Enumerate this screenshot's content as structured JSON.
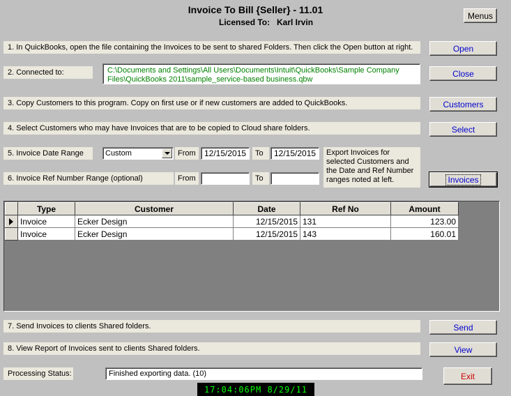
{
  "header": {
    "title": "Invoice To Bill {Seller} - 11.01",
    "licensed_label": "Licensed To:",
    "licensed_name": "Karl Irvin"
  },
  "buttons": {
    "menus": "Menus",
    "open": "Open",
    "close": "Close",
    "customers": "Customers",
    "select": "Select",
    "invoices": "Invoices",
    "send": "Send",
    "view": "View",
    "exit": "Exit"
  },
  "steps": {
    "step1": "1. In QuickBooks, open the  file containing the Invoices to be sent to shared Folders. Then click the Open button at right.",
    "step2": "2. Connected to:",
    "connected_path": "C:\\Documents and Settings\\All Users\\Documents\\Intuit\\QuickBooks\\Sample Company Files\\QuickBooks 2011\\sample_service-based business.qbw",
    "step3": "3. Copy Customers to this program. Copy on first use or if new customers are added to QuickBooks.",
    "step4": "4. Select Customers who may have Invoices that are to be copied to Cloud share folders.",
    "step5": "5. Invoice Date Range",
    "step6": "6. Invoice Ref Number Range (optional)",
    "step7": "7. Send Invoices to clients Shared folders.",
    "step8": "8. View Report of Invoices sent to clients Shared folders."
  },
  "date_range": {
    "preset": "Custom",
    "from_label": "From",
    "from_value": "12/15/2015",
    "to_label": "To",
    "to_value": "12/15/2015"
  },
  "ref_range": {
    "from_label": "From",
    "from_value": "",
    "to_label": "To",
    "to_value": ""
  },
  "export_note": "Export Invoices for selected Customers and the Date and Ref Number ranges noted at left.",
  "grid": {
    "columns": [
      "Type",
      "Customer",
      "Date",
      "Ref No",
      "Amount"
    ],
    "rows": [
      {
        "type": "Invoice",
        "customer": "Ecker Design",
        "date": "12/15/2015",
        "ref": "131",
        "amount": "123.00"
      },
      {
        "type": "Invoice",
        "customer": "Ecker Design",
        "date": "12/15/2015",
        "ref": "143",
        "amount": "160.01"
      }
    ]
  },
  "status": {
    "label": "Processing Status:",
    "value": "Finished exporting data. (10)"
  },
  "clock": "17:04:06PM 8/29/11"
}
